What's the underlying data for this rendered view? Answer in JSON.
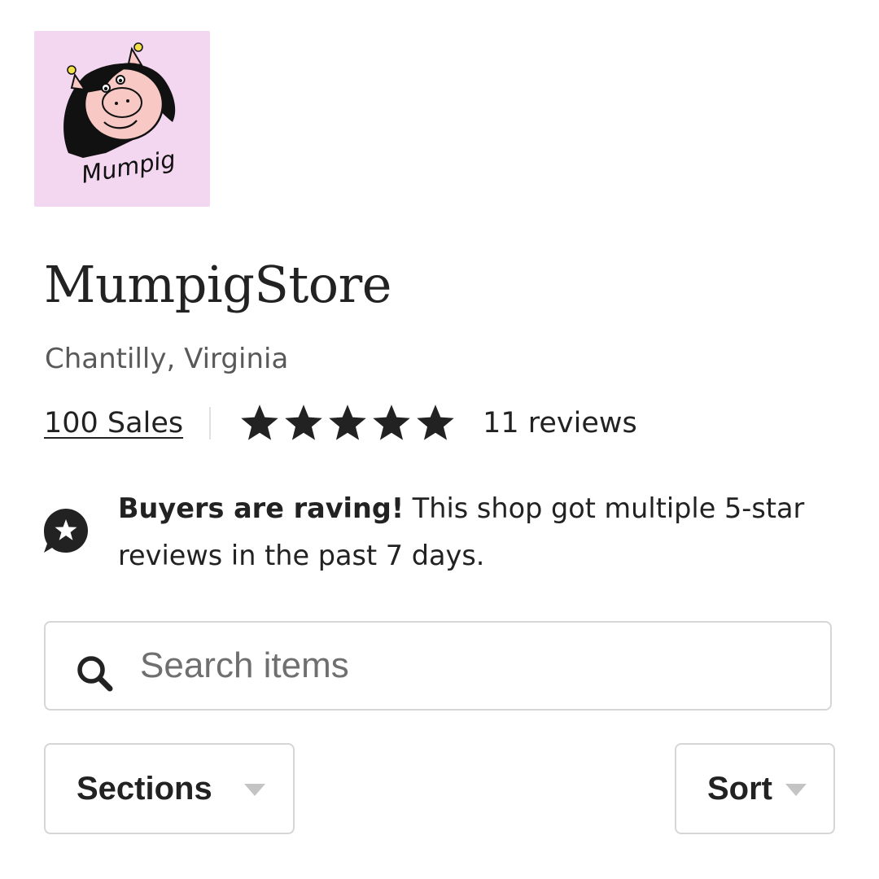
{
  "shop": {
    "logo_text": "Mumpig",
    "name": "MumpigStore",
    "location": "Chantilly, Virginia"
  },
  "stats": {
    "sales_label": "100 Sales",
    "rating": 5,
    "rating_max": 5,
    "reviews_label": "11 reviews"
  },
  "highlight": {
    "icon": "star-badge-icon",
    "title": "Buyers are raving!",
    "text": " This shop got multiple 5-star reviews in the past 7 days."
  },
  "search": {
    "placeholder": "Search items",
    "value": "",
    "icon": "search-icon"
  },
  "filters": {
    "sections_label": "Sections",
    "sort_label": "Sort"
  },
  "colors": {
    "logo_background": "#f3d6ef",
    "text": "#222222",
    "muted_text": "#595959",
    "border": "#d6d6d6",
    "star": "#222222"
  }
}
